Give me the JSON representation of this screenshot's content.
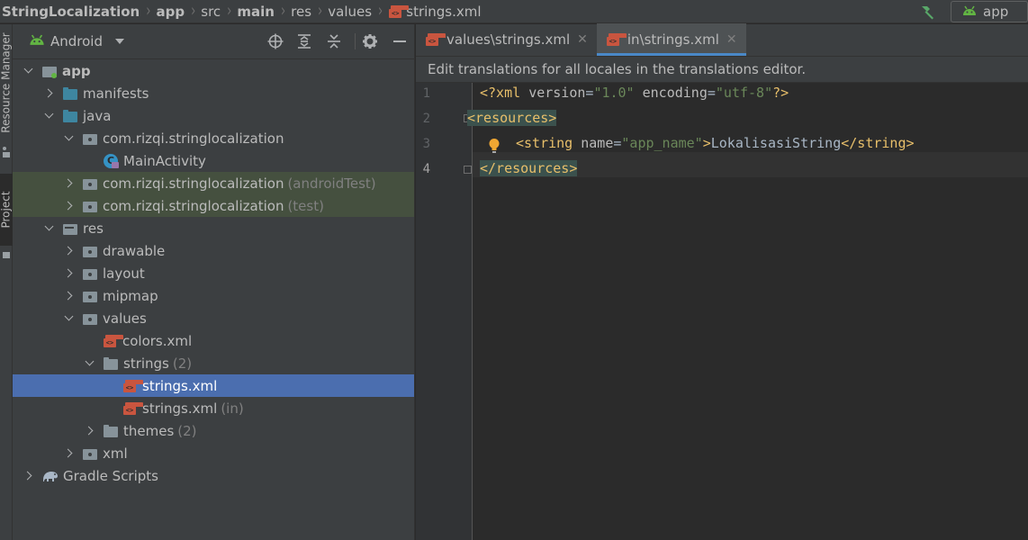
{
  "breadcrumb": {
    "items": [
      {
        "label": "StringLocalization",
        "bold": true
      },
      {
        "label": "app",
        "bold": true
      },
      {
        "label": "src",
        "bold": false
      },
      {
        "label": "main",
        "bold": true
      },
      {
        "label": "res",
        "bold": false
      },
      {
        "label": "values",
        "bold": false
      }
    ],
    "file_label": "strings.xml"
  },
  "run_config": {
    "label": "app"
  },
  "tool_stripe": {
    "resource_manager": "Resource Manager",
    "project": "Project"
  },
  "project_panel": {
    "view_mode": "Android",
    "tree": [
      {
        "label": "app",
        "bold": true,
        "icon": "module",
        "depth": 0,
        "chevron": "down"
      },
      {
        "label": "manifests",
        "icon": "folder-blue",
        "depth": 1,
        "chevron": "right"
      },
      {
        "label": "java",
        "icon": "folder-blue",
        "depth": 1,
        "chevron": "down"
      },
      {
        "label": "com.rizqi.stringlocalization",
        "icon": "package",
        "depth": 2,
        "chevron": "down"
      },
      {
        "label": "MainActivity",
        "icon": "activity-icon",
        "depth": 3,
        "chevron": "none"
      },
      {
        "label": "com.rizqi.stringlocalization",
        "suffix": "(androidTest)",
        "icon": "package",
        "depth": 2,
        "chevron": "right",
        "highlight": true
      },
      {
        "label": "com.rizqi.stringlocalization",
        "suffix": "(test)",
        "icon": "package",
        "depth": 2,
        "chevron": "right",
        "highlight": true
      },
      {
        "label": "res",
        "icon": "res-folder",
        "depth": 1,
        "chevron": "down"
      },
      {
        "label": "drawable",
        "icon": "package",
        "depth": 2,
        "chevron": "right"
      },
      {
        "label": "layout",
        "icon": "package",
        "depth": 2,
        "chevron": "right"
      },
      {
        "label": "mipmap",
        "icon": "package",
        "depth": 2,
        "chevron": "right"
      },
      {
        "label": "values",
        "icon": "package",
        "depth": 2,
        "chevron": "down"
      },
      {
        "label": "colors.xml",
        "icon": "xml-icon",
        "depth": 3,
        "chevron": "none"
      },
      {
        "label": "strings",
        "suffix": "(2)",
        "icon": "folder-gray",
        "depth": 3,
        "chevron": "down"
      },
      {
        "label": "strings.xml",
        "icon": "xml-icon",
        "depth": 4,
        "chevron": "none",
        "selected": true
      },
      {
        "label": "strings.xml",
        "suffix": "(in)",
        "icon": "xml-icon",
        "depth": 4,
        "chevron": "none"
      },
      {
        "label": "themes",
        "suffix": "(2)",
        "icon": "folder-gray",
        "depth": 3,
        "chevron": "right"
      },
      {
        "label": "xml",
        "icon": "package",
        "depth": 2,
        "chevron": "right"
      },
      {
        "label": "Gradle Scripts",
        "icon": "gradle-icon",
        "depth": 0,
        "chevron": "right"
      }
    ]
  },
  "editor": {
    "tabs": [
      {
        "label": "values\\strings.xml",
        "active": false
      },
      {
        "label": "in\\strings.xml",
        "active": true
      }
    ],
    "banner": "Edit translations for all locales in the translations editor.",
    "line_numbers": [
      "1",
      "2",
      "3",
      "4"
    ],
    "code": {
      "line1": {
        "open": "<?xml ",
        "attr1": "version",
        "eq1": "=",
        "val1": "\"1.0\"",
        "sp": " ",
        "attr2": "encoding",
        "eq2": "=",
        "val2": "\"utf-8\"",
        "close": "?>"
      },
      "line2": {
        "tag": "<resources>"
      },
      "line3": {
        "open": "<string ",
        "attr": "name",
        "eq": "=",
        "val": "\"app_name\"",
        "gt": ">",
        "text": "LokalisasiString",
        "close": "</string>"
      },
      "line4": {
        "tag": "</resources>"
      }
    }
  },
  "colors": {
    "selection": "#4b6eaf",
    "tab_underline": "#4a88c7",
    "xml_icon": "#c9553f",
    "android_green": "#62b543"
  }
}
